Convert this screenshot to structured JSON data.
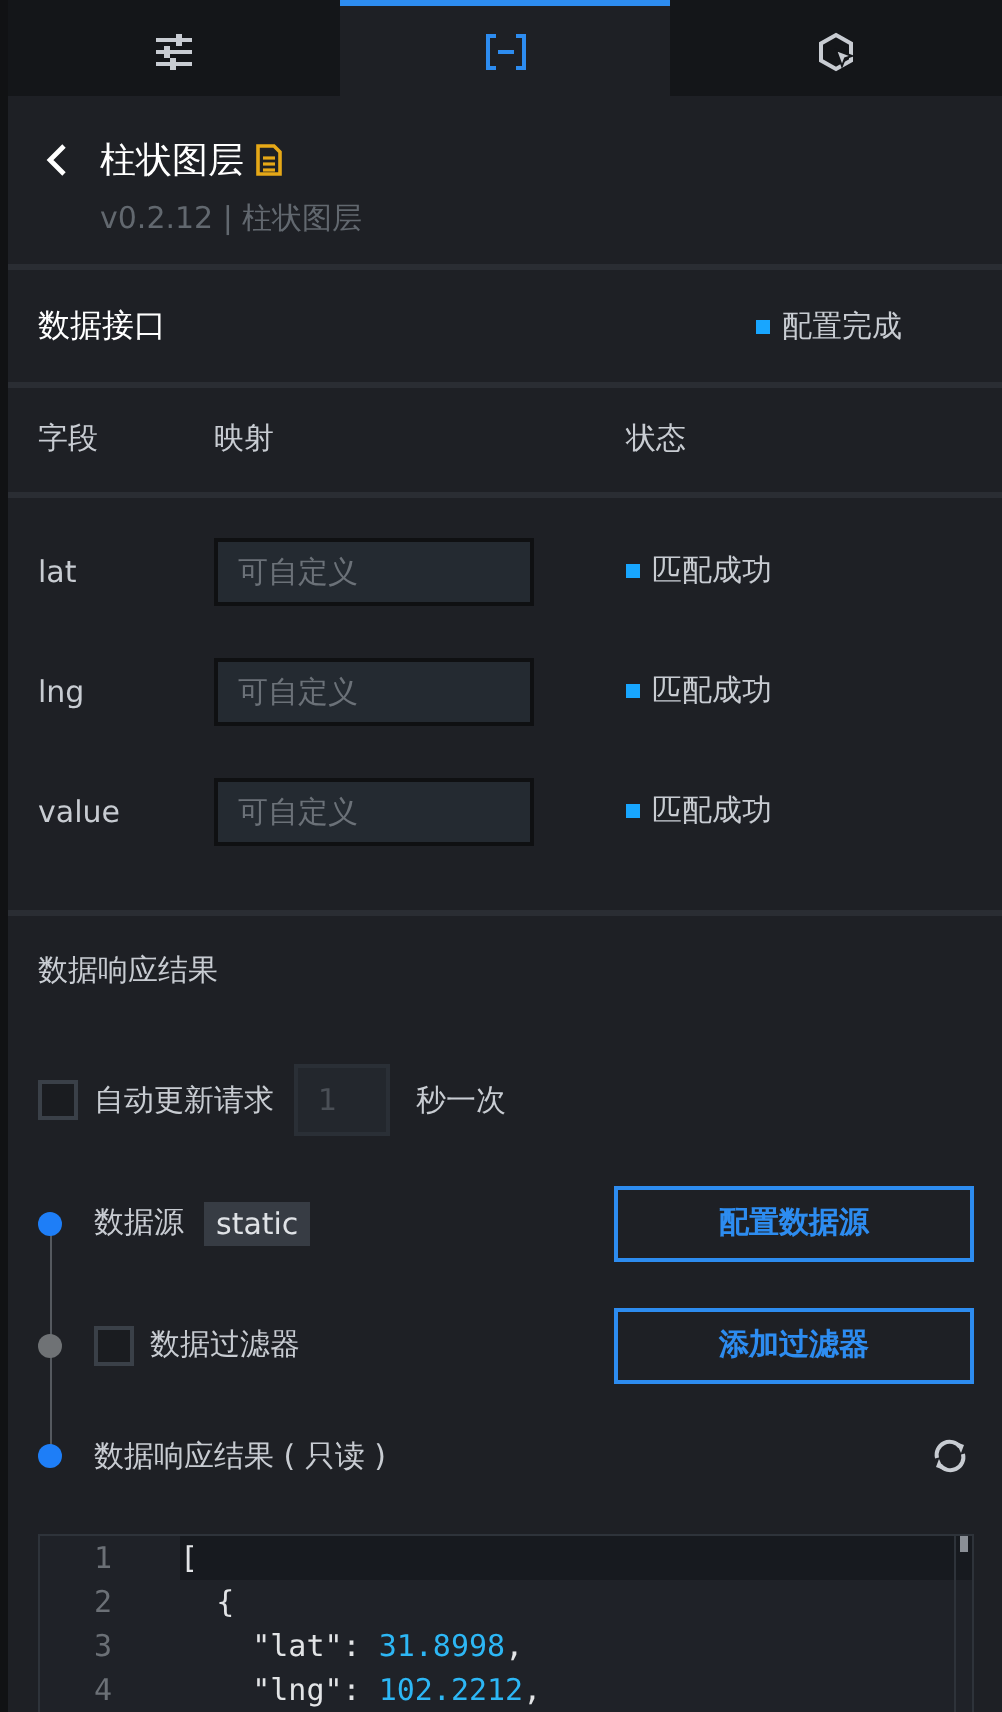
{
  "tabs": [
    {
      "kind": "sliders",
      "selected": false
    },
    {
      "kind": "brackets",
      "selected": true
    },
    {
      "kind": "cursor",
      "selected": false
    }
  ],
  "header": {
    "title": "柱状图层",
    "subtitle": "v0.2.12 | 柱状图层"
  },
  "data_interface": {
    "title": "数据接口",
    "status": "配置完成"
  },
  "fields_table": {
    "columns": [
      "字段",
      "映射",
      "状态"
    ],
    "rows": [
      {
        "field": "lat",
        "placeholder": "可自定义",
        "status": "匹配成功"
      },
      {
        "field": "lng",
        "placeholder": "可自定义",
        "status": "匹配成功"
      },
      {
        "field": "value",
        "placeholder": "可自定义",
        "status": "匹配成功"
      }
    ]
  },
  "response_section": {
    "title": "数据响应结果"
  },
  "auto_update": {
    "checked": false,
    "label": "自动更新请求",
    "interval_placeholder": "1",
    "unit": "秒一次"
  },
  "steps": [
    {
      "kind": "source",
      "active": true,
      "label": "数据源",
      "tag": "static",
      "button": "配置数据源"
    },
    {
      "kind": "filter",
      "active": false,
      "checked": false,
      "label": "数据过滤器",
      "button": "添加过滤器"
    },
    {
      "kind": "result",
      "active": true,
      "label": "数据响应结果 ( 只读 )"
    }
  ],
  "code_editor": {
    "lines": [
      {
        "number": "1",
        "tokens": [
          {
            "kind": "punct",
            "text": "["
          }
        ]
      },
      {
        "number": "2",
        "tokens": [
          {
            "kind": "punct",
            "text": "{"
          }
        ]
      },
      {
        "number": "3",
        "tokens": [
          {
            "kind": "key",
            "text": "\"lat\""
          },
          {
            "kind": "punct",
            "text": ": "
          },
          {
            "kind": "number",
            "text": "31.8998"
          },
          {
            "kind": "punct",
            "text": ","
          }
        ]
      },
      {
        "number": "4",
        "tokens": [
          {
            "kind": "key",
            "text": "\"lng\""
          },
          {
            "kind": "punct",
            "text": ": "
          },
          {
            "kind": "number",
            "text": "102.2212"
          },
          {
            "kind": "punct",
            "text": ","
          }
        ]
      }
    ]
  }
}
